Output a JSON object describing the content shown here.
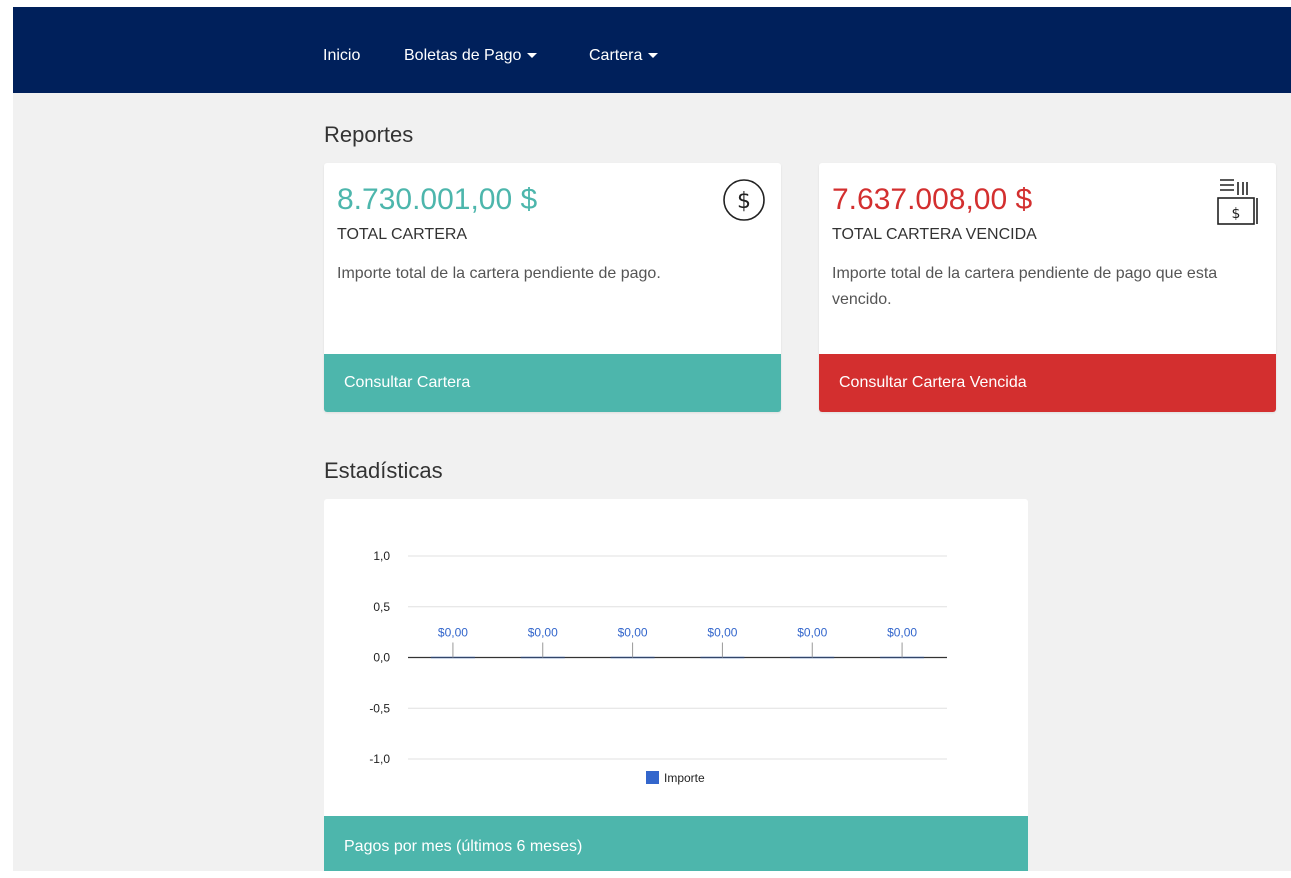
{
  "nav": {
    "items": [
      {
        "label": "Inicio",
        "dropdown": false
      },
      {
        "label": "Boletas de Pago",
        "dropdown": true
      },
      {
        "label": "Cartera",
        "dropdown": true
      }
    ]
  },
  "colors": {
    "navbar": "#00205b",
    "teal": "#4db6ac",
    "red": "#d32f2f",
    "bar": "#3366cc"
  },
  "reportes": {
    "title": "Reportes",
    "cards": [
      {
        "amount": "8.730.001,00 $",
        "label": "TOTAL CARTERA",
        "description": "Importe total de la cartera pendiente de pago.",
        "button": "Consultar Cartera",
        "icon": "dollar-circle-icon"
      },
      {
        "amount": "7.637.008,00 $",
        "label": "TOTAL CARTERA VENCIDA",
        "description": "Importe total de la cartera pendiente de pago que esta vencido.",
        "button": "Consultar Cartera Vencida",
        "icon": "overdue-invoice-icon"
      }
    ]
  },
  "estadisticas": {
    "title": "Estadísticas",
    "footer": "Pagos por mes (últimos 6 meses)"
  },
  "chart_data": {
    "type": "bar",
    "categories": [
      "",
      "",
      "",
      "",
      "",
      ""
    ],
    "series": [
      {
        "name": "Importe",
        "values": [
          0,
          0,
          0,
          0,
          0,
          0
        ]
      }
    ],
    "data_labels": [
      "$0,00",
      "$0,00",
      "$0,00",
      "$0,00",
      "$0,00",
      "$0,00"
    ],
    "y_ticks": [
      "1,0",
      "0,5",
      "0,0",
      "-0,5",
      "-1,0"
    ],
    "ylim": [
      -1,
      1
    ],
    "grid": true,
    "legend": "bottom"
  }
}
